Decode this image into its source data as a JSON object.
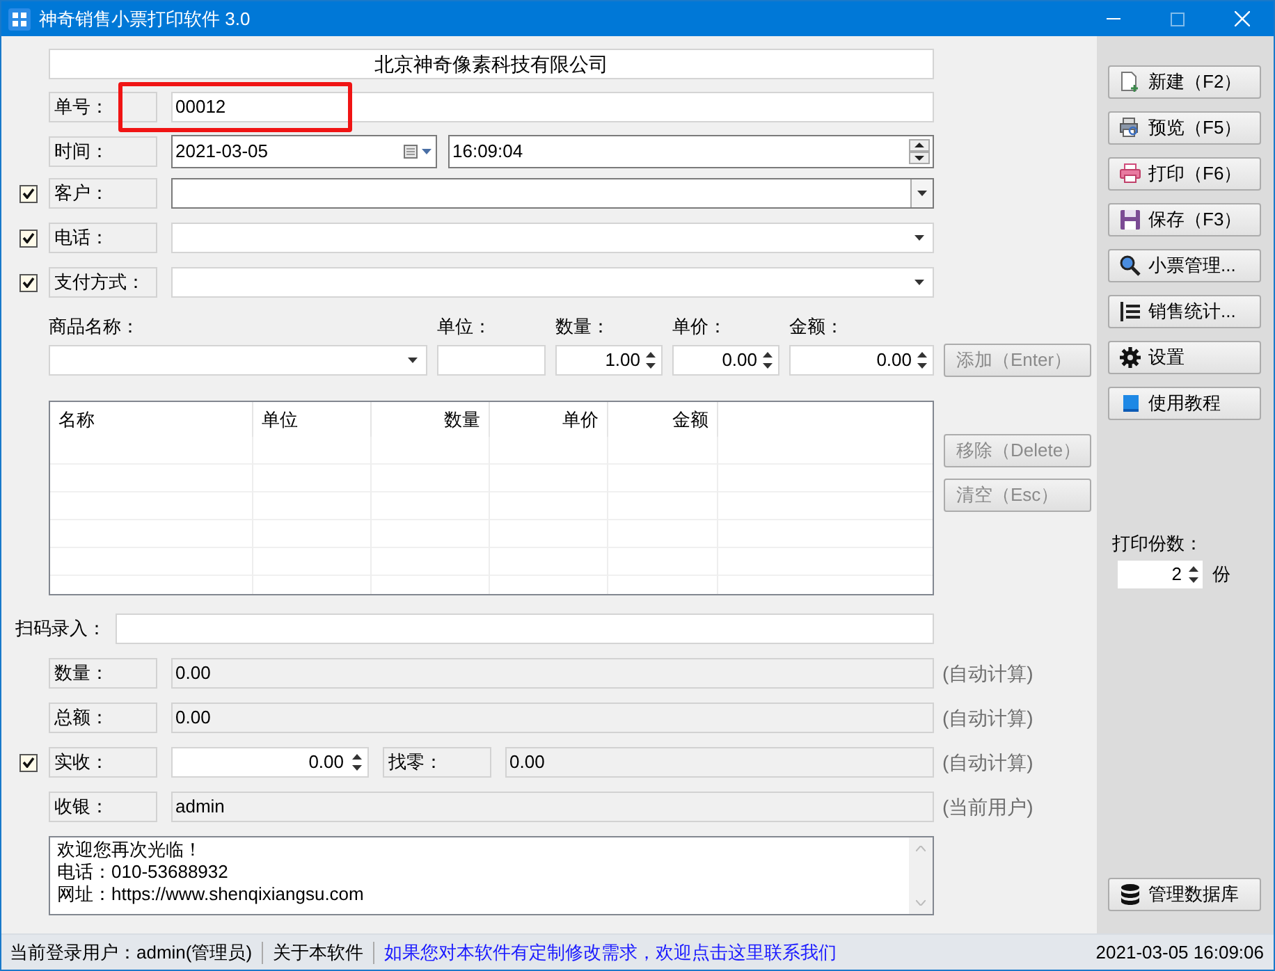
{
  "window": {
    "title": "神奇销售小票打印软件 3.0"
  },
  "company": "北京神奇像素科技有限公司",
  "order_no": {
    "label": "单号：",
    "value": "00012",
    "highlighted": true
  },
  "time": {
    "label": "时间：",
    "date": "2021-03-05",
    "time": "16:09:04"
  },
  "options": [
    {
      "label": "客户：",
      "checked": true,
      "kind": "editable-combo"
    },
    {
      "label": "电话：",
      "checked": true,
      "kind": "combo"
    },
    {
      "label": "支付方式：",
      "checked": true,
      "kind": "combo"
    }
  ],
  "item_entry": {
    "columns": [
      {
        "label": "商品名称：",
        "kind": "combo"
      },
      {
        "label": "单位：",
        "kind": "text"
      },
      {
        "label": "数量：",
        "kind": "spin",
        "value": "1.00"
      },
      {
        "label": "单价：",
        "kind": "spin",
        "value": "0.00"
      },
      {
        "label": "金额：",
        "kind": "spin",
        "value": "0.00"
      }
    ],
    "add_button": {
      "label": "添加（Enter）",
      "disabled": true
    }
  },
  "table": {
    "columns": [
      "名称",
      "单位",
      "数量",
      "单价",
      "金额"
    ]
  },
  "list_buttons": [
    {
      "label": "移除（Delete）",
      "disabled": true
    },
    {
      "label": "清空（Esc）",
      "disabled": true
    }
  ],
  "scan": {
    "label": "扫码录入："
  },
  "totals": [
    {
      "kind": "readonly",
      "label": "数量：",
      "value": "0.00",
      "note": "(自动计算)"
    },
    {
      "kind": "readonly",
      "label": "总额：",
      "value": "0.00",
      "note": "(自动计算)"
    },
    {
      "kind": "received",
      "label": "实收：",
      "checked": true,
      "value": "0.00",
      "change_label": "找零：",
      "change_value": "0.00",
      "note": "(自动计算)"
    },
    {
      "kind": "readonly",
      "label": "收银：",
      "value": "admin",
      "note": "(当前用户)"
    }
  ],
  "footer_text": [
    "欢迎您再次光临！",
    "电话：010-53688932",
    "网址：https://www.shenqixiangsu.com"
  ],
  "sidebar": {
    "buttons": [
      {
        "label": "新建（F2）"
      },
      {
        "label": "预览（F5）"
      },
      {
        "label": "打印（F6）"
      },
      {
        "label": "保存（F3）"
      },
      {
        "label": "小票管理..."
      },
      {
        "label": "销售统计..."
      },
      {
        "label": "设置"
      },
      {
        "label": "使用教程"
      }
    ],
    "copies": {
      "label": "打印份数：",
      "value": "2",
      "unit": "份"
    },
    "db_button": {
      "label": "管理数据库"
    }
  },
  "status_bar": {
    "user": "当前登录用户：admin(管理员)",
    "about": "关于本软件",
    "link": "如果您对本软件有定制修改需求，欢迎点击这里联系我们",
    "clock": "2021-03-05 16:09:06"
  }
}
